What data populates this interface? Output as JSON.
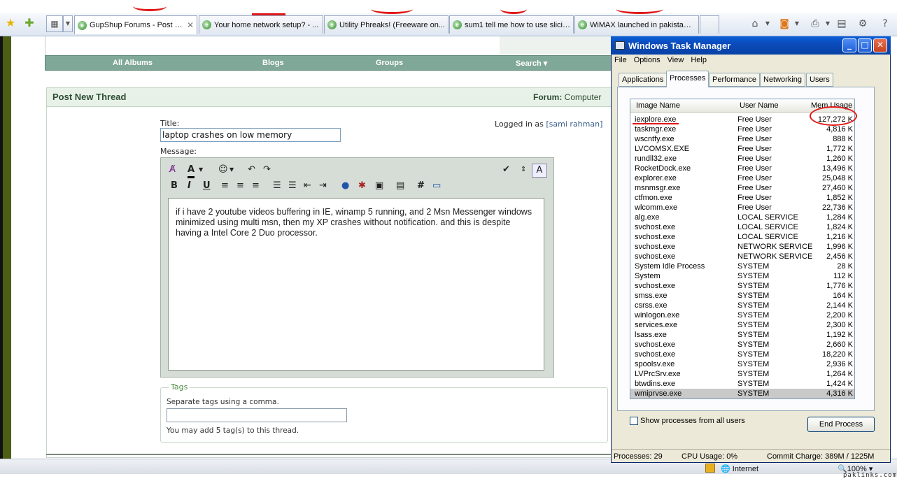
{
  "browser": {
    "tabs": [
      {
        "label": "GupShup Forums - Post N...",
        "close": "✕"
      },
      {
        "label": "Your home network setup? - ..."
      },
      {
        "label": "Utility Phreaks! (Freeware on..."
      },
      {
        "label": "sum1 tell me how to use slicin..."
      },
      {
        "label": "WiMAX launched in pakistan -..."
      }
    ],
    "status": {
      "zone": "Internet",
      "zoom": "100%"
    }
  },
  "page": {
    "nav": [
      "All Albums",
      "Blogs",
      "Groups",
      "Search ▾"
    ],
    "section_title": "Post New Thread",
    "forum_label": "Forum:",
    "forum_name": "Computer",
    "title_label": "Title:",
    "title_value": "laptop crashes on low memory",
    "logged_in_prefix": "Logged in as ",
    "logged_in_user": "[sami rahman]",
    "message_label": "Message:",
    "message_text": "if i have 2 youtube videos buffering in IE, winamp 5 running, and 2 Msn Messenger windows minimized using multi msn, then my XP crashes without notification. and this is despite having a Intel Core 2 Duo processor.",
    "tags_legend": "Tags",
    "tags_hint": "Separate tags using a comma.",
    "tags_max": "You may add 5 tag(s) to this thread."
  },
  "taskmanager": {
    "title": "Windows Task Manager",
    "menu": [
      "File",
      "Options",
      "View",
      "Help"
    ],
    "tabs": [
      "Applications",
      "Processes",
      "Performance",
      "Networking",
      "Users"
    ],
    "active_tab": "Processes",
    "columns": [
      "Image Name",
      "User Name",
      "Mem Usage"
    ],
    "processes": [
      [
        "iexplore.exe",
        "Free User",
        "127,272 K"
      ],
      [
        "taskmgr.exe",
        "Free User",
        "4,816 K"
      ],
      [
        "wscntfy.exe",
        "Free User",
        "888 K"
      ],
      [
        "LVCOMSX.EXE",
        "Free User",
        "1,772 K"
      ],
      [
        "rundll32.exe",
        "Free User",
        "1,260 K"
      ],
      [
        "RocketDock.exe",
        "Free User",
        "13,496 K"
      ],
      [
        "explorer.exe",
        "Free User",
        "25,048 K"
      ],
      [
        "msnmsgr.exe",
        "Free User",
        "27,460 K"
      ],
      [
        "ctfmon.exe",
        "Free User",
        "1,852 K"
      ],
      [
        "wlcomm.exe",
        "Free User",
        "22,736 K"
      ],
      [
        "alg.exe",
        "LOCAL SERVICE",
        "1,284 K"
      ],
      [
        "svchost.exe",
        "LOCAL SERVICE",
        "1,824 K"
      ],
      [
        "svchost.exe",
        "LOCAL SERVICE",
        "1,216 K"
      ],
      [
        "svchost.exe",
        "NETWORK SERVICE",
        "1,996 K"
      ],
      [
        "svchost.exe",
        "NETWORK SERVICE",
        "2,456 K"
      ],
      [
        "System Idle Process",
        "SYSTEM",
        "28 K"
      ],
      [
        "System",
        "SYSTEM",
        "112 K"
      ],
      [
        "svchost.exe",
        "SYSTEM",
        "1,776 K"
      ],
      [
        "smss.exe",
        "SYSTEM",
        "164 K"
      ],
      [
        "csrss.exe",
        "SYSTEM",
        "2,144 K"
      ],
      [
        "winlogon.exe",
        "SYSTEM",
        "2,200 K"
      ],
      [
        "services.exe",
        "SYSTEM",
        "2,300 K"
      ],
      [
        "lsass.exe",
        "SYSTEM",
        "1,192 K"
      ],
      [
        "svchost.exe",
        "SYSTEM",
        "2,660 K"
      ],
      [
        "svchost.exe",
        "SYSTEM",
        "18,220 K"
      ],
      [
        "spoolsv.exe",
        "SYSTEM",
        "2,936 K"
      ],
      [
        "LVPrcSrv.exe",
        "SYSTEM",
        "1,264 K"
      ],
      [
        "btwdins.exe",
        "SYSTEM",
        "1,424 K"
      ],
      [
        "wmiprvse.exe",
        "SYSTEM",
        "4,316 K"
      ]
    ],
    "selected_row": 28,
    "show_all_label": "Show processes from all users",
    "end_process_label": "End Process",
    "status": {
      "processes": "Processes: 29",
      "cpu": "CPU Usage: 0%",
      "commit": "Commit Charge: 389M / 1225M"
    }
  },
  "watermark": "paklinks.com",
  "colors": {
    "annotation": "#e01818",
    "xp_titlebar": "#0b4bbb",
    "forum_nav": "#80a899"
  }
}
